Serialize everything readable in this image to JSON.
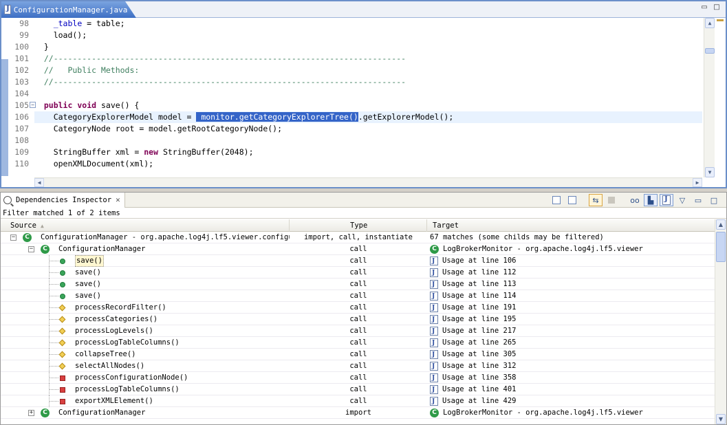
{
  "editor": {
    "tab_title": "ConfigurationManager.java",
    "tab_close": "✕",
    "code": [
      {
        "num": "98",
        "tokens": [
          {
            "t": "    "
          },
          {
            "t": "_table",
            "c": "fld"
          },
          {
            "t": " = table;"
          }
        ]
      },
      {
        "num": "99",
        "tokens": [
          {
            "t": "    load();"
          }
        ]
      },
      {
        "num": "100",
        "tokens": [
          {
            "t": "  }"
          }
        ]
      },
      {
        "num": "101",
        "tokens": [
          {
            "t": "  //--------------------------------------------------------------------------",
            "c": "cm"
          }
        ]
      },
      {
        "num": "102",
        "tokens": [
          {
            "t": "  //   Public Methods:",
            "c": "cm"
          }
        ]
      },
      {
        "num": "103",
        "tokens": [
          {
            "t": "  //--------------------------------------------------------------------------",
            "c": "cm"
          }
        ]
      },
      {
        "num": "104",
        "tokens": [
          {
            "t": ""
          }
        ]
      },
      {
        "num": "105",
        "fold": true,
        "tokens": [
          {
            "t": "  "
          },
          {
            "t": "public",
            "c": "kw"
          },
          {
            "t": " "
          },
          {
            "t": "void",
            "c": "kw"
          },
          {
            "t": " save() {"
          }
        ]
      },
      {
        "num": "106",
        "current": true,
        "tokens": [
          {
            "t": "    CategoryExplorerModel model = "
          },
          {
            "t": " monitor.getCategoryExplorerTree()",
            "c": "sel"
          },
          {
            "t": ".getExplorerModel();"
          }
        ]
      },
      {
        "num": "107",
        "tokens": [
          {
            "t": "    CategoryNode root = model.getRootCategoryNode();"
          }
        ]
      },
      {
        "num": "108",
        "tokens": [
          {
            "t": ""
          }
        ]
      },
      {
        "num": "109",
        "tokens": [
          {
            "t": "    StringBuffer xml = "
          },
          {
            "t": "new",
            "c": "kw"
          },
          {
            "t": " StringBuffer(2048);"
          }
        ]
      },
      {
        "num": "110",
        "tokens": [
          {
            "t": "    openXMLDocument(xml);"
          }
        ]
      }
    ]
  },
  "inspector": {
    "view_title": "Dependencies Inspector",
    "view_close": "✕",
    "filter_status": "Filter matched 1 of 2 items",
    "columns": {
      "source": "Source",
      "type": "Type",
      "target": "Target"
    },
    "rows": [
      {
        "level": 0,
        "icon": "class",
        "source": "ConfigurationManager  -  org.apache.log4j.lf5.viewer.configu",
        "type": "import, call, instantiate",
        "target": "67 matches (some childs may be filtered)",
        "target_icon": "none",
        "twisty": "−"
      },
      {
        "level": 1,
        "icon": "class",
        "source": "ConfigurationManager",
        "type": "call",
        "target": "LogBrokerMonitor  -  org.apache.log4j.lf5.viewer",
        "target_icon": "class",
        "twisty": "−"
      },
      {
        "level": 2,
        "icon": "public",
        "source": "save()",
        "type": "call",
        "target": "Usage at line 106",
        "target_icon": "usage",
        "selected": true
      },
      {
        "level": 2,
        "icon": "public",
        "source": "save()",
        "type": "call",
        "target": "Usage at line 112",
        "target_icon": "usage"
      },
      {
        "level": 2,
        "icon": "public",
        "source": "save()",
        "type": "call",
        "target": "Usage at line 113",
        "target_icon": "usage"
      },
      {
        "level": 2,
        "icon": "public",
        "source": "save()",
        "type": "call",
        "target": "Usage at line 114",
        "target_icon": "usage"
      },
      {
        "level": 2,
        "icon": "protected",
        "source": "processRecordFilter()",
        "type": "call",
        "target": "Usage at line 191",
        "target_icon": "usage"
      },
      {
        "level": 2,
        "icon": "protected",
        "source": "processCategories()",
        "type": "call",
        "target": "Usage at line 195",
        "target_icon": "usage"
      },
      {
        "level": 2,
        "icon": "protected",
        "source": "processLogLevels()",
        "type": "call",
        "target": "Usage at line 217",
        "target_icon": "usage"
      },
      {
        "level": 2,
        "icon": "protected",
        "source": "processLogTableColumns()",
        "type": "call",
        "target": "Usage at line 265",
        "target_icon": "usage"
      },
      {
        "level": 2,
        "icon": "protected",
        "source": "collapseTree()",
        "type": "call",
        "target": "Usage at line 305",
        "target_icon": "usage"
      },
      {
        "level": 2,
        "icon": "protected",
        "source": "selectAllNodes()",
        "type": "call",
        "target": "Usage at line 312",
        "target_icon": "usage"
      },
      {
        "level": 2,
        "icon": "private",
        "source": "processConfigurationNode()",
        "type": "call",
        "target": "Usage at line 358",
        "target_icon": "usage"
      },
      {
        "level": 2,
        "icon": "private",
        "source": "processLogTableColumns()",
        "type": "call",
        "target": "Usage at line 401",
        "target_icon": "usage"
      },
      {
        "level": 2,
        "icon": "private",
        "source": "exportXMLElement()",
        "type": "call",
        "target": "Usage at line 429",
        "target_icon": "usage"
      },
      {
        "level": 1,
        "icon": "class",
        "source": "ConfigurationManager",
        "type": "import",
        "target": "LogBrokerMonitor  -  org.apache.log4j.lf5.viewer",
        "target_icon": "class",
        "twisty": "+"
      }
    ]
  },
  "icons": {
    "class_glyph": "C",
    "maximize": "□",
    "minimize": "▭",
    "menu": "▽"
  }
}
